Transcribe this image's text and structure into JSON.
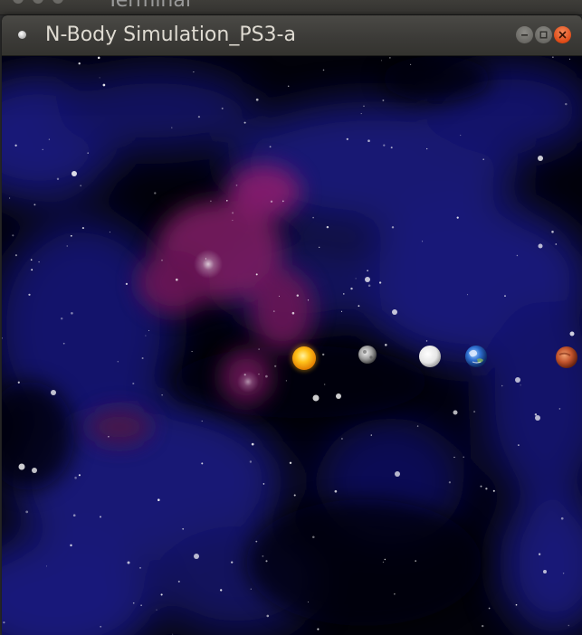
{
  "background_window": {
    "title": "Terminal"
  },
  "window": {
    "title": "N-Body Simulation_PS3-a",
    "controls": {
      "minimize_icon": "minimize-icon",
      "maximize_icon": "maximize-icon",
      "close_icon": "close-icon"
    }
  },
  "simulation": {
    "background": "starfield-nebula",
    "bodies": [
      {
        "name": "sun",
        "icon": "sun-body",
        "color": "#ffc21a"
      },
      {
        "name": "mercury",
        "icon": "mercury-body",
        "color": "#b9b9b9"
      },
      {
        "name": "venus",
        "icon": "venus-body",
        "color": "#f2f2f2"
      },
      {
        "name": "earth",
        "icon": "earth-body",
        "color": "#2e6fd0"
      },
      {
        "name": "mars",
        "icon": "mars-body",
        "color": "#c2542d"
      }
    ]
  },
  "colors": {
    "titlebar": "#3b3a37",
    "title_text": "#dfdbd2",
    "close_button": "#df4a16",
    "nebula_blue": "#1a1a7a",
    "nebula_magenta": "#8a1d6e"
  }
}
